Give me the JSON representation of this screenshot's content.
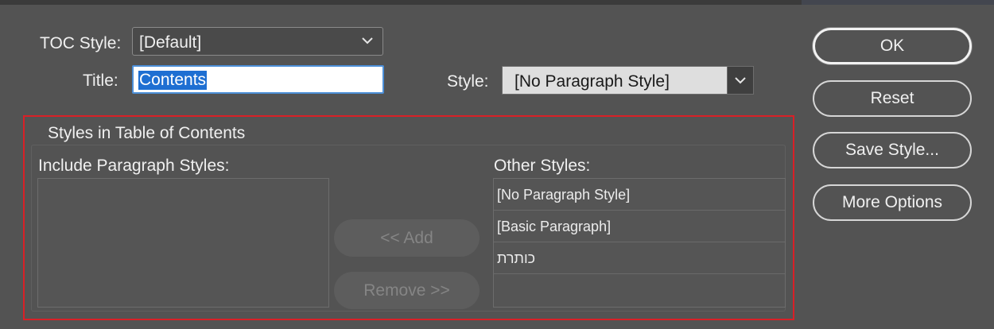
{
  "form": {
    "toc_style_label": "TOC Style:",
    "toc_style_value": "[Default]",
    "title_label": "Title:",
    "title_value": "Contents",
    "style_label": "Style:",
    "style_value": "[No Paragraph Style]"
  },
  "styles_group": {
    "heading": "Styles in Table of Contents",
    "include_label": "Include Paragraph Styles:",
    "include_items": [],
    "other_label": "Other Styles:",
    "other_items": [
      "[No Paragraph Style]",
      "[Basic Paragraph]",
      "כותרת",
      ""
    ],
    "add_button": "<< Add",
    "remove_button": "Remove >>"
  },
  "buttons": {
    "ok": "OK",
    "reset": "Reset",
    "save_style": "Save Style...",
    "more_options": "More Options"
  },
  "icons": {
    "toc_dropdown": "chevron-down-icon",
    "style_dropdown": "chevron-down-icon"
  },
  "colors": {
    "dialog_background": "#535353",
    "selection_highlight": "#1e6fd2",
    "focus_outline": "#4c8fd8",
    "annotation_box": "#d92027"
  }
}
